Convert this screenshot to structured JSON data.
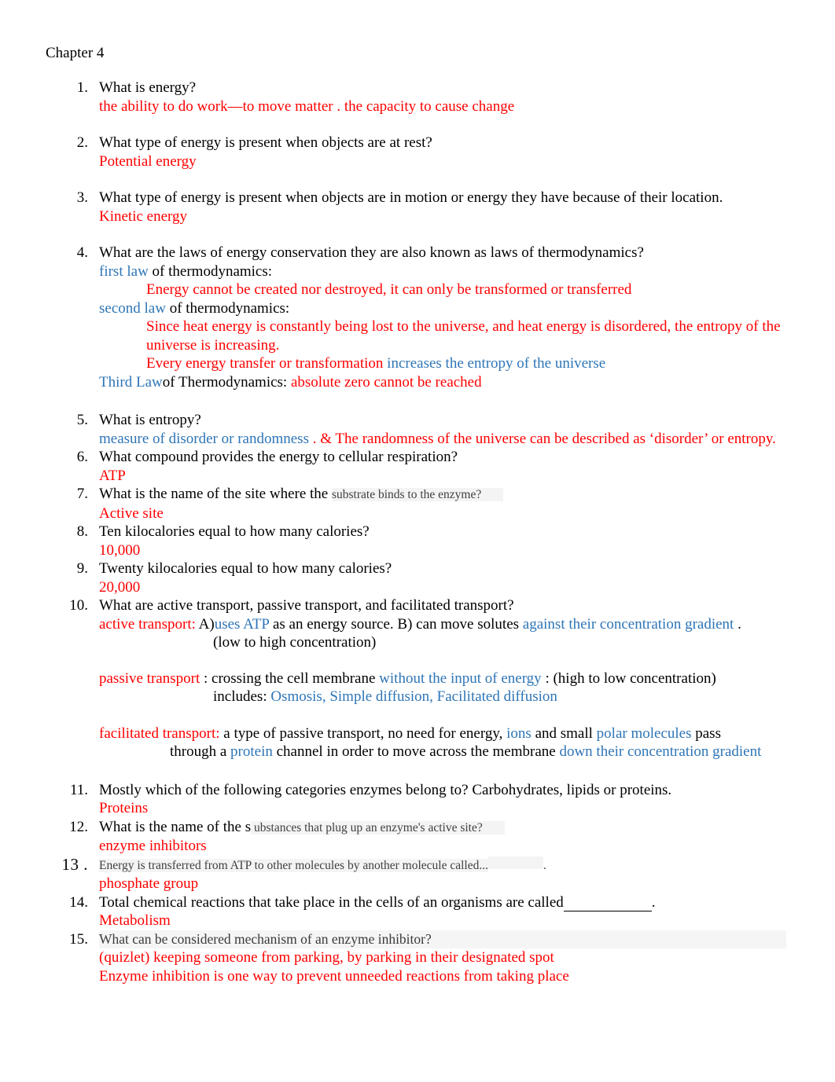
{
  "document": {
    "title": "Chapter 4"
  },
  "colors": {
    "answer_red": "#FF0000",
    "highlight_blue": "#2E75B6",
    "body_black": "#000000",
    "small_text_gray": "#3f3f3f",
    "highlight_bg": "#f4f4f4"
  },
  "questions": [
    {
      "number": "1.",
      "question": "What is energy?",
      "answer": "the ability to do work—to move matter . the capacity to cause change"
    },
    {
      "number": "2.",
      "question": "What type of energy is present when objects are at rest?",
      "answer": "Potential energy"
    },
    {
      "number": "3.",
      "question": "What type of energy is present when objects are in motion or energy they have because of their location.",
      "answer": "Kinetic energy"
    },
    {
      "number": "4.",
      "question": "What are the laws of energy conservation they are also known as laws of thermodynamics?",
      "law1_blue": "first law",
      "law1_black": " of thermodynamics:",
      "law1_answer": "Energy cannot be created nor destroyed, it can only be transformed or transferred",
      "law2_blue": "second law",
      "law2_black": " of thermodynamics:",
      "law2_answer_a": "Since heat energy is constantly being lost to the universe, and heat energy is disordered, the entropy of the universe is increasing.",
      "law2_answer_b_red": "Every energy transfer or transformation ",
      "law2_answer_b_blue": " increases the entropy of the universe",
      "law3_blue": "Third Law",
      "law3_black": "of Thermodynamics: ",
      "law3_answer": "absolute zero cannot be reached"
    },
    {
      "number": "5.",
      "question": "What is entropy?",
      "answer_blue": "measure of disorder or randomness ",
      "answer_red": " . & The randomness of the universe can be described as ‘disorder’ or entropy."
    },
    {
      "number": "6.",
      "question": "What compound provides the energy to cellular respiration?",
      "answer": "ATP"
    },
    {
      "number": "7.",
      "question_main": "What is the name of the site where the ",
      "question_small": "substrate binds to the enzyme?",
      "answer": "Active site"
    },
    {
      "number": "8.",
      "question": "Ten kilocalories equal to how many calories?",
      "answer": "10,000"
    },
    {
      "number": "9.",
      "question": "Twenty kilocalories equal to how many calories?",
      "answer": "20,000"
    },
    {
      "number": "10.",
      "question": "What are active transport, passive transport, and facilitated transport?",
      "active_label": "active transport: ",
      "active_black_a": " A)",
      "active_blue_a": "uses ATP",
      "active_black_b": " as an energy source. B) can move solutes ",
      "active_blue_b": "against their concentration gradient",
      "active_black_c": "  .",
      "active_line2": "(low to high concentration)",
      "passive_label": "passive transport",
      "passive_black_a": " : crossing the cell membrane ",
      "passive_blue_a": "without the input of energy",
      "passive_black_b": " : (high to low concentration)",
      "passive_line2_black": "includes: ",
      "passive_line2_blue": "Osmosis, Simple diffusion, Facilitated diffusion",
      "facilitated_label": "facilitated transport: ",
      "facilitated_black_a": "  a type of passive transport, no need for energy,  ",
      "facilitated_blue_a": " ions",
      "facilitated_black_b": " and small ",
      "facilitated_blue_b": "polar molecules",
      "facilitated_black_c": " pass",
      "facilitated_line2_black_a": "through a ",
      "facilitated_line2_blue_a": "protein",
      "facilitated_line2_black_b": " channel in order to move across the membrane  ",
      "facilitated_line2_blue_b": " down their concentration gradient"
    },
    {
      "number": "11.",
      "question": "Mostly which of the following categories enzymes belong to? Carbohydrates, lipids or proteins.",
      "answer": "Proteins"
    },
    {
      "number": "12.",
      "question_main": "What is the name of the s",
      "question_small": " ubstances that plug up an enzyme's active site?",
      "answer": "enzyme inhibitors"
    },
    {
      "number": "13 .",
      "question_small": "Energy is transferred from ATP to other molecules by another molecule called...",
      "question_tail": ".",
      "answer": "phosphate group"
    },
    {
      "number": "14.",
      "question_pre": "Total chemical reactions that take place in the cells of an organisms are called",
      "question_post": ".",
      "answer": "Metabolism"
    },
    {
      "number": "15.",
      "question": " What can be considered  mechanism of an enzyme inhibitor?",
      "answer_line1": "(quizlet) keeping someone from parking, by parking in their designated spot",
      "answer_line2": "Enzyme inhibition is one way to prevent unneeded reactions from taking place"
    }
  ]
}
